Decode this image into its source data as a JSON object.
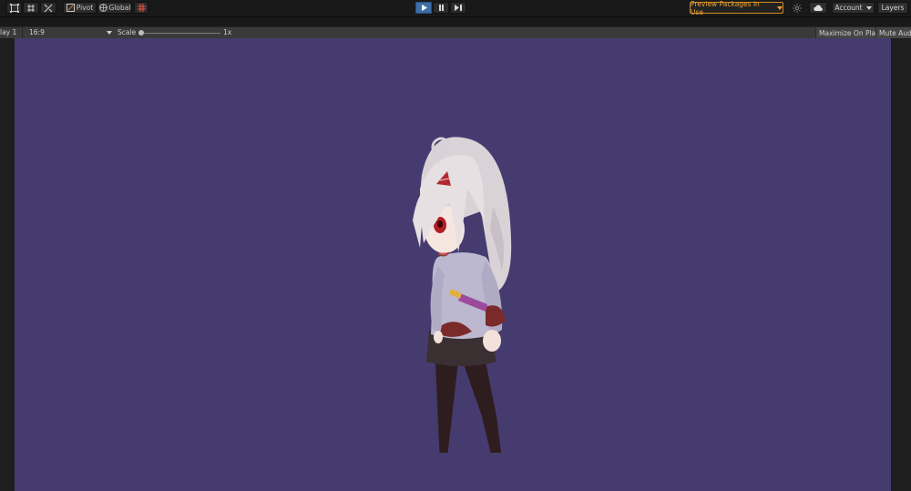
{
  "toolbar": {
    "tools": [
      {
        "name": "rect-tool",
        "icon": "rect-tool-icon"
      },
      {
        "name": "move-snap-tool",
        "icon": "grid-move-icon"
      },
      {
        "name": "custom-tool",
        "icon": "tools-icon"
      }
    ],
    "pivot_label": "Pivot",
    "global_label": "Global",
    "grid_icon": "grid-snap-icon",
    "playmode": {
      "play": "play-icon",
      "pause": "pause-icon",
      "step": "step-icon",
      "play_active": true
    },
    "preview_packages_label": "Preview Packages in Use",
    "account_label": "Account",
    "layers_label": "Layers",
    "colors": {
      "accent_play": "#3d6ea8",
      "preview_warning": "#e8a13a"
    }
  },
  "game_view": {
    "display_label": "lay 1",
    "aspect_label": "16:9",
    "scale_label": "Scale",
    "scale_value": "1x",
    "maximize_label": "Maximize On Play",
    "mute_label": "Mute Audio",
    "background_color": "#463b6f"
  }
}
